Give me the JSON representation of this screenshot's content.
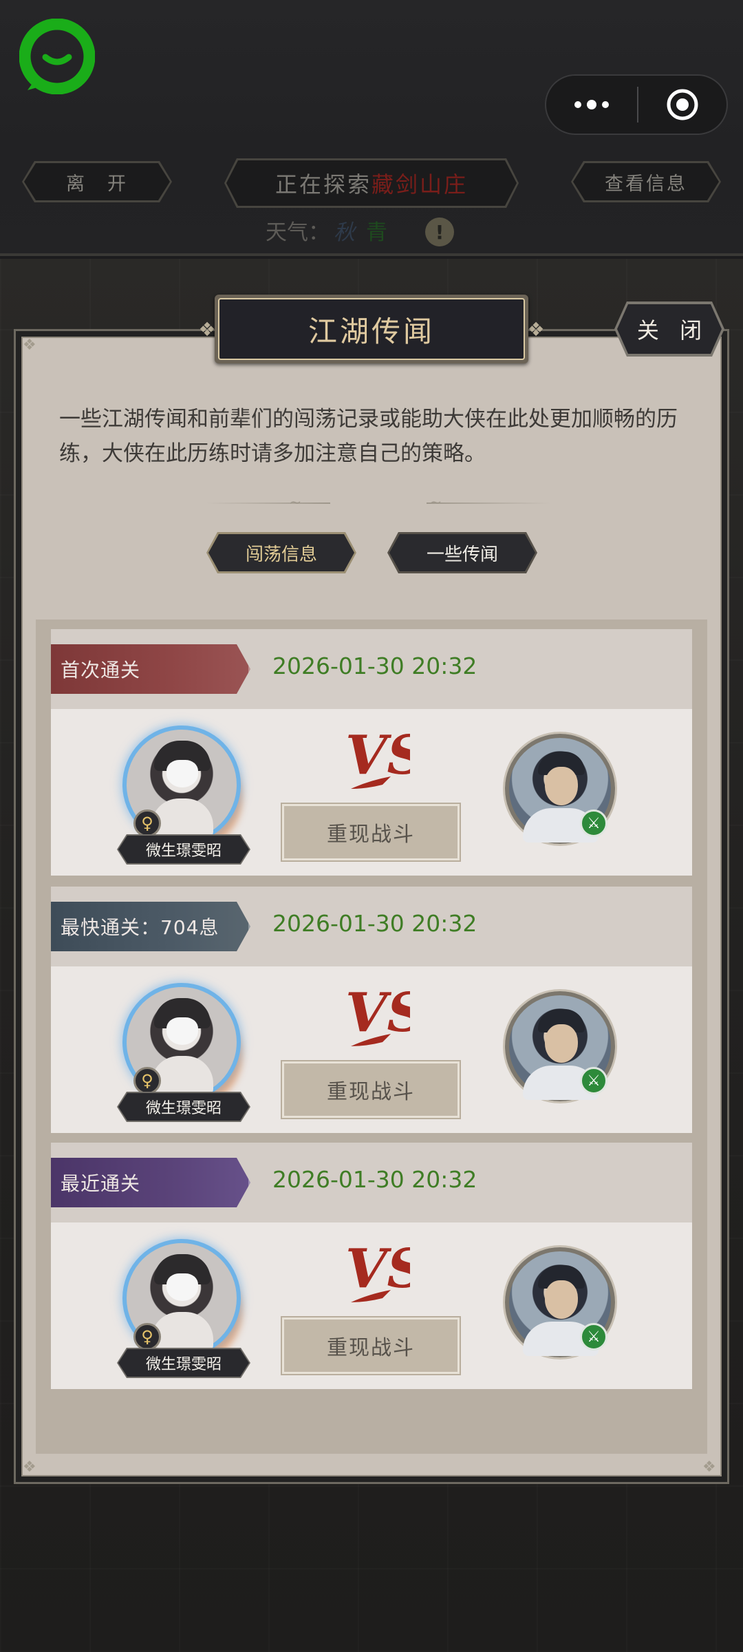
{
  "topbar": {
    "leave_label": "离　开",
    "exploring_prefix": "正在探索",
    "exploring_place": "藏剑山庄",
    "view_info_label": "查看信息",
    "weather_label": "天气：",
    "weather_value": "秋",
    "weather_value2": "青",
    "warn_icon": "!"
  },
  "dialog": {
    "title": "江湖传闻",
    "close_label": "关 闭",
    "description": "一些江湖传闻和前辈们的闯荡记录或能助大侠在此处更加顺畅的历练，大侠在此历练时请多加注意自己的策略。",
    "tabs": [
      {
        "label": "闯荡信息",
        "active": true
      },
      {
        "label": "一些传闻",
        "active": false
      }
    ]
  },
  "records": [
    {
      "badge": "首次通关",
      "badge_color": "#8a4242",
      "date": "2026-01-30 20:32",
      "player_name": "微生璟雯昭",
      "gender_symbol": "♀",
      "vs_label": "VS",
      "replay_label": "重现战斗",
      "enemy_badge_icon": "sword-icon"
    },
    {
      "badge": "最快通关：704息",
      "badge_color": "#4a5864",
      "date": "2026-01-30 20:32",
      "player_name": "微生璟雯昭",
      "gender_symbol": "♀",
      "vs_label": "VS",
      "replay_label": "重现战斗",
      "enemy_badge_icon": "sword-icon"
    },
    {
      "badge": "最近通关",
      "badge_color": "#574077",
      "date": "2026-01-30 20:32",
      "player_name": "微生璟雯昭",
      "gender_symbol": "♀",
      "vs_label": "VS",
      "replay_label": "重现战斗",
      "enemy_badge_icon": "sword-icon"
    }
  ],
  "colors": {
    "date_green": "#3f7d25",
    "title_gold": "#e0caa0",
    "vs_red": "#a52a1f",
    "app_logo_green": "#1aad19"
  }
}
